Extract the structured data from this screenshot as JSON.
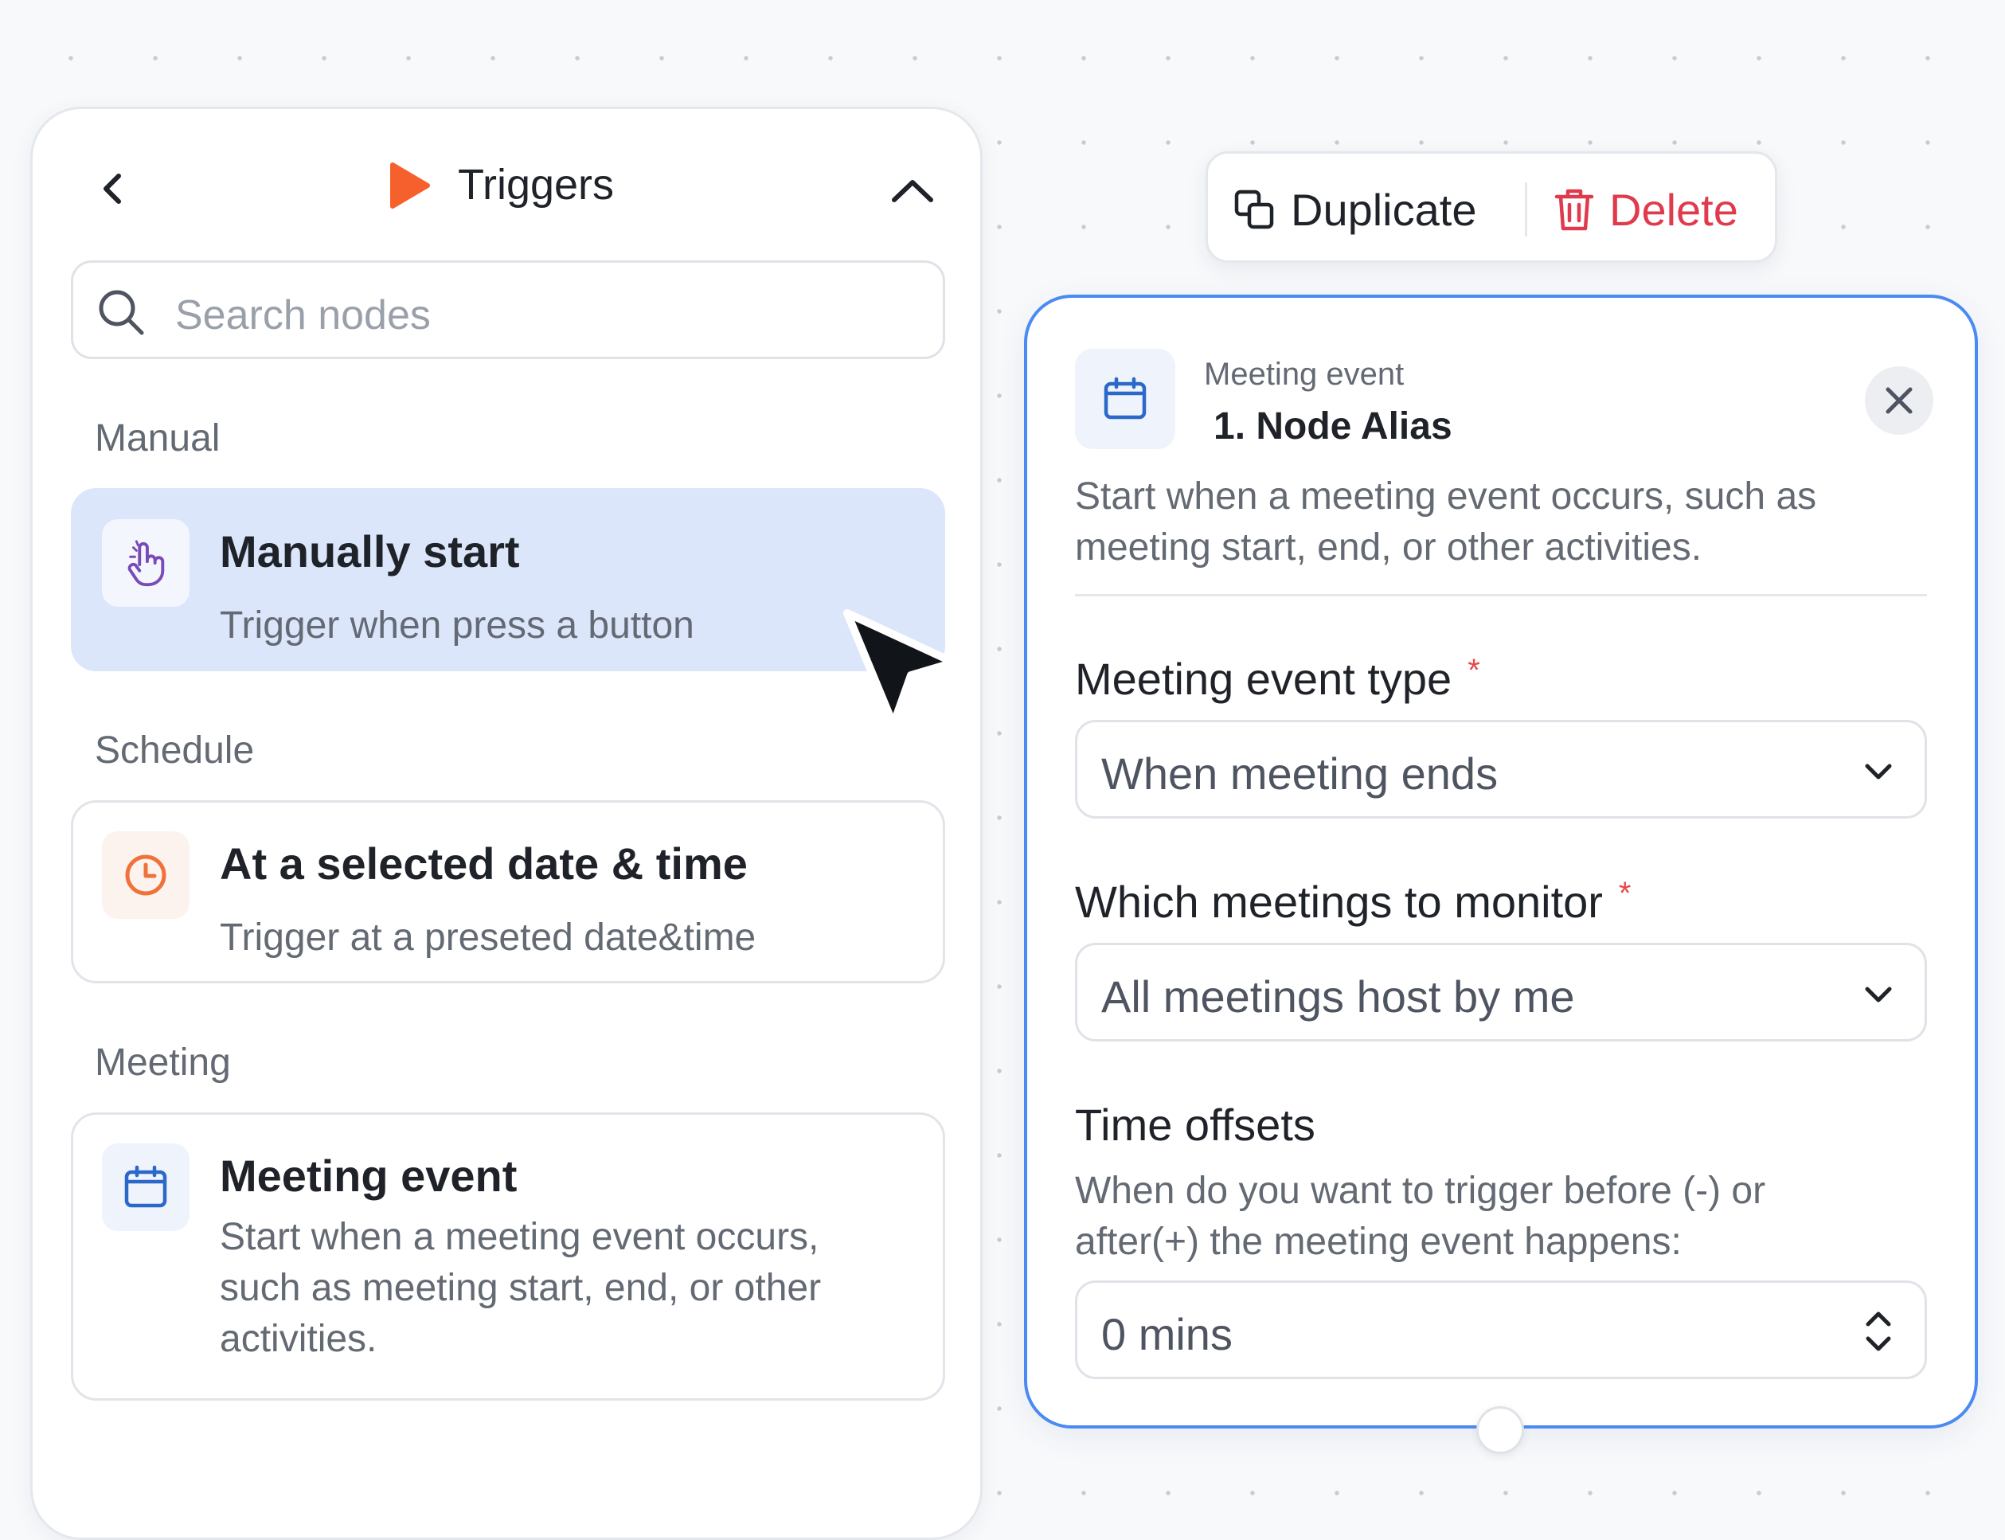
{
  "triggers_panel": {
    "title": "Triggers",
    "search": {
      "placeholder": "Search nodes",
      "value": ""
    },
    "sections": [
      {
        "label": "Manual",
        "items": [
          {
            "title": "Manually start",
            "description": "Trigger when press a button",
            "icon": "hand-pointer-icon",
            "selected": true
          }
        ]
      },
      {
        "label": "Schedule",
        "items": [
          {
            "title": "At a selected date & time",
            "description": "Trigger at a preseted date&time",
            "icon": "clock-icon",
            "selected": false
          }
        ]
      },
      {
        "label": "Meeting",
        "items": [
          {
            "title": "Meeting event",
            "description": "Start when a meeting event occurs, such as meeting start, end, or other activities.",
            "icon": "calendar-icon",
            "selected": false
          }
        ]
      }
    ]
  },
  "toolbar": {
    "duplicate_label": "Duplicate",
    "delete_label": "Delete"
  },
  "node_config": {
    "node_type": "Meeting event",
    "node_alias": "1. Node Alias",
    "description": "Start when a meeting event occurs, such as meeting start, end, or other activities.",
    "fields": {
      "event_type": {
        "label": "Meeting event type",
        "required": true,
        "value": "When meeting ends"
      },
      "monitor": {
        "label": "Which meetings to monitor",
        "required": true,
        "value": "All meetings host by me"
      },
      "time_offsets": {
        "label": "Time offsets",
        "help": "When do you want to trigger before (-) or after(+)  the meeting event happens:",
        "value": "0 mins"
      }
    },
    "required_marker": "*"
  },
  "colors": {
    "accent": "#4a8af4",
    "selected_card": "#dbe6fb",
    "trigger_play": "#f5602c",
    "delete": "#e03a4d",
    "clock": "#f0723a",
    "calendar": "#2c68c8",
    "hand": "#7a4ab8"
  }
}
